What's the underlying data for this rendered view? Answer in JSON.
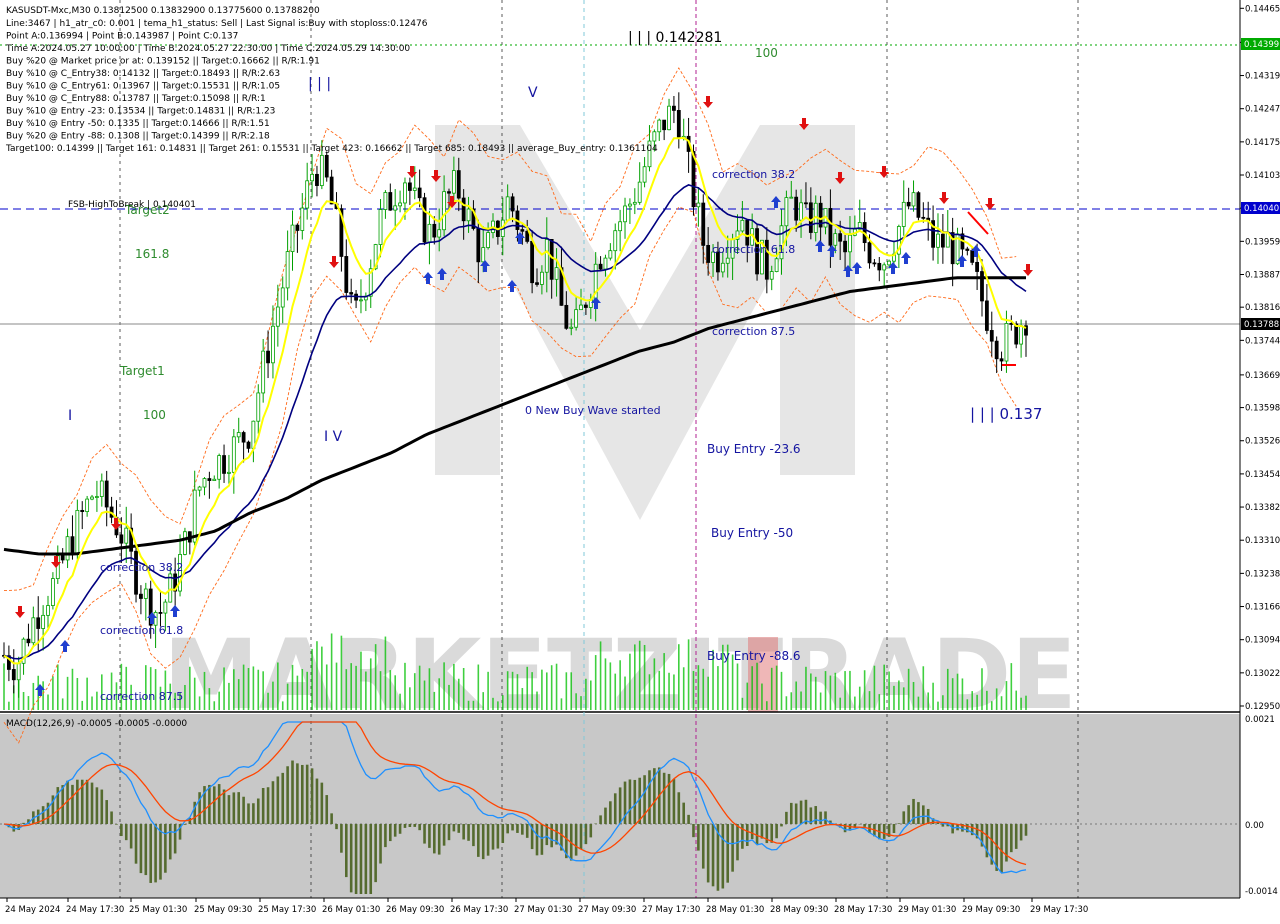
{
  "window": {
    "symbol_line": "KASUSDT-Mxc,M30  0.13812500 0.13832900 0.13775600 0.13788200"
  },
  "info_lines": [
    "Line:3467 | h1_atr_c0: 0.001 | tema_h1_status: Sell | Last Signal is:Buy with stoploss:0.12476",
    "Point A:0.136994 | Point B:0.143987 | Point C:0.137",
    "Time A:2024.05.27 10:00:00 | Time B:2024.05.27 22:30:00 | Time C:2024.05.29 14:30:00",
    "Buy %20 @ Market price or at: 0.139152 || Target:0.16662 || R/R:1.91",
    "Buy %10 @ C_Entry38: 0.14132 || Target:0.18493 || R/R:2.63",
    "Buy %10 @ C_Entry61: 0.13967 || Target:0.15531 || R/R:1.05",
    "Buy %10 @ C_Entry88: 0.13787 || Target:0.15098 || R/R:1",
    "Buy %10 @ Entry -23: 0.13534 || Target:0.14831 || R/R:1.23",
    "Buy %10 @ Entry -50: 0.1335 || Target:0.14666 || R/R:1.51",
    "Buy %20 @ Entry -88: 0.1308 || Target:0.14399 || R/R:2.18",
    "Target100: 0.14399 || Target 161: 0.14831 || Target 261: 0.15531 || Target 423: 0.16662 || Target 685: 0.18493 || average_Buy_entry: 0.1361104"
  ],
  "watermark": {
    "text": "MARKETZITRADE"
  },
  "colors": {
    "ma_fast": "#ffff00",
    "ma_mid": "#000080",
    "ma_slow": "#000000",
    "bull_candle": "#00a000",
    "bear_candle": "#000000",
    "volume": "#00c000",
    "macd_main": "#1e90ff",
    "macd_signal": "#ff4500",
    "macd_hist": "#556b2f",
    "dashed_blue": "#0000cd",
    "target_green": "#00aa00",
    "price_label_bg": "#000000",
    "price_label_green": "#00aa00",
    "price_label_blue": "#0000cd"
  },
  "annotations": {
    "wave_v_label": "V",
    "wave_iii_top_label": "| | |",
    "wave_iii_price_label": "| | | 0.142281",
    "wave_iii_bottom_label": "| | | 0.137",
    "wave_i_label": "I",
    "wave_iv_label": "I V",
    "target100_top": "100",
    "target100_left": "100",
    "target1": "Target1",
    "target2": "Target2",
    "fib_161": "161.8",
    "fsb_label": "FSB-HighToBreak | 0.140401",
    "correction_382_right": "correction 38.2",
    "correction_618_right": "correction 61.8",
    "correction_875_right": "correction 87.5",
    "new_buy_wave": "0 New Buy Wave started",
    "buy_entry_236": "Buy Entry -23.6",
    "buy_entry_50": "Buy Entry -50",
    "buy_entry_886": "Buy Entry -88.6",
    "correction_382_left": "correction 38.2",
    "correction_618_left": "correction 61.8",
    "correction_875_left": "correction 87.5"
  },
  "price_axis": {
    "labels": [
      "0.14465",
      "0.14391",
      "0.14319",
      "0.14247",
      "0.14175",
      "0.14103",
      "0.14031",
      "0.13959",
      "0.13887",
      "0.13816",
      "0.13744",
      "0.13669",
      "0.13598",
      "0.13526",
      "0.13454",
      "0.13382",
      "0.13310",
      "0.13238",
      "0.13166",
      "0.13094",
      "0.13022",
      "0.12950"
    ],
    "highlight_top": "0.14399",
    "highlight_fsb": "0.14040",
    "highlight_current": "0.13788"
  },
  "macd": {
    "label": "MACD(12,26,9) -0.0005 -0.0005 -0.0000",
    "axis_labels": [
      "0.0021",
      "0.00",
      "-0.0014"
    ]
  },
  "time_axis": {
    "labels": [
      "24 May 2024",
      "24 May 17:30",
      "25 May 01:30",
      "25 May 09:30",
      "25 May 17:30",
      "26 May 01:30",
      "26 May 09:30",
      "26 May 17:30",
      "27 May 01:30",
      "27 May 09:30",
      "27 May 17:30",
      "28 May 01:30",
      "28 May 09:30",
      "28 May 17:30",
      "29 May 01:30",
      "29 May 09:30",
      "29 May 17:30"
    ]
  },
  "chart_data": {
    "type": "candlestick",
    "symbol": "KASUSDT-Mxc",
    "timeframe": "M30",
    "ylim": [
      0.1295,
      0.1447
    ],
    "levels": {
      "target100": 0.14399,
      "fsb_high_to_break": 0.140401,
      "current_price": 0.13788,
      "point_a": 0.136994,
      "point_b": 0.143987,
      "point_c": 0.137
    },
    "close_series": [
      0.1306,
      0.1304,
      0.1312,
      0.1318,
      0.1322,
      0.133,
      0.1336,
      0.1342,
      0.1338,
      0.1333,
      0.1325,
      0.1318,
      0.1315,
      0.1321,
      0.133,
      0.1342,
      0.1347,
      0.1349,
      0.1352,
      0.1355,
      0.1368,
      0.138,
      0.1392,
      0.1402,
      0.1413,
      0.1408,
      0.1395,
      0.1378,
      0.1388,
      0.14,
      0.1406,
      0.141,
      0.1402,
      0.1397,
      0.1404,
      0.1408,
      0.14,
      0.1392,
      0.1398,
      0.1405,
      0.1398,
      0.139,
      0.1395,
      0.1382,
      0.1375,
      0.1384,
      0.1393,
      0.1398,
      0.1402,
      0.1408,
      0.1416,
      0.1422,
      0.1425,
      0.141,
      0.1396,
      0.1392,
      0.1397,
      0.1402,
      0.1394,
      0.139,
      0.1398,
      0.1405,
      0.14,
      0.1402,
      0.1396,
      0.1393,
      0.1398,
      0.1394,
      0.1392,
      0.1398,
      0.1404,
      0.14,
      0.1395,
      0.1396,
      0.1392,
      0.1388,
      0.138,
      0.1373,
      0.1376,
      0.138
    ],
    "ma_slow_series": [
      0.1329,
      0.1328,
      0.1328,
      0.1329,
      0.133,
      0.1331,
      0.1333,
      0.1337,
      0.134,
      0.1344,
      0.1347,
      0.135,
      0.1354,
      0.1357,
      0.136,
      0.1363,
      0.1366,
      0.1369,
      0.1372,
      0.1374,
      0.1377,
      0.1379,
      0.1381,
      0.1383,
      0.1385,
      0.1386,
      0.1387,
      0.1388,
      0.1388,
      0.1388
    ],
    "series": [],
    "xlabel": "",
    "ylabel": ""
  }
}
